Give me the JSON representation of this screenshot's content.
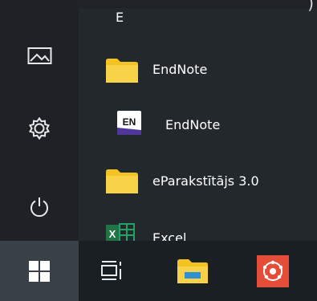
{
  "partial_top_right_text": ")",
  "app_list": {
    "group_letter": "E",
    "items": [
      {
        "label": "EndNote",
        "icon": "folder-icon"
      },
      {
        "label": "EndNote",
        "icon": "endnote-app-icon",
        "icon_text": "EN"
      },
      {
        "label": "eParakstītājs 3.0",
        "icon": "folder-icon"
      },
      {
        "label": "Excel",
        "icon": "excel-icon",
        "icon_text": "X"
      }
    ]
  },
  "left_rail": {
    "items": [
      {
        "name": "pictures",
        "icon": "picture-icon"
      },
      {
        "name": "settings",
        "icon": "gear-icon"
      },
      {
        "name": "power",
        "icon": "power-icon"
      }
    ]
  },
  "taskbar": {
    "items": [
      {
        "name": "start",
        "icon": "windows-icon"
      },
      {
        "name": "task-view",
        "icon": "task-view-icon"
      },
      {
        "name": "file-explorer",
        "icon": "folder-icon"
      },
      {
        "name": "red-app",
        "icon": "red-app-icon"
      }
    ]
  },
  "colors": {
    "background": "#23282c",
    "taskbar": "#1a1f24",
    "start_highlight": "#3a4047",
    "folder_yellow": "#f3c322",
    "endnote_purple": "#50389b",
    "excel_green": "#217346",
    "red_app": "#e44e39"
  }
}
